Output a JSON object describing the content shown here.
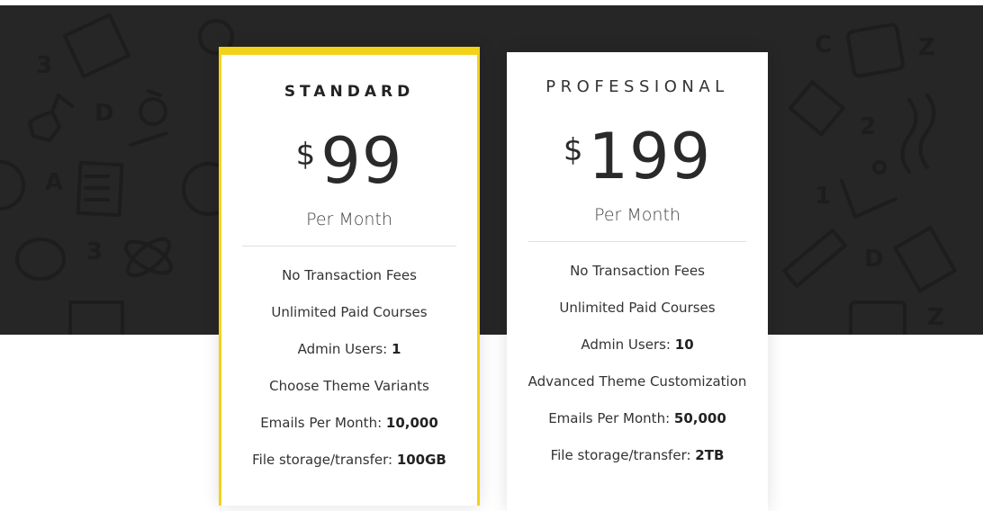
{
  "colors": {
    "accent": "#f2d318",
    "hero_background": "#262626",
    "card_background": "#ffffff",
    "text": "#333333"
  },
  "plans": [
    {
      "name": "STANDARD",
      "currency": "$",
      "amount": "99",
      "period": "Per Month",
      "highlighted": true,
      "features": [
        {
          "label": "No Transaction Fees",
          "value": ""
        },
        {
          "label": "Unlimited Paid Courses",
          "value": ""
        },
        {
          "label": "Admin Users: ",
          "value": "1"
        },
        {
          "label": "Choose Theme Variants",
          "value": ""
        },
        {
          "label": "Emails Per Month: ",
          "value": "10,000"
        },
        {
          "label": "File storage/transfer: ",
          "value": "100GB"
        }
      ]
    },
    {
      "name": "PROFESSIONAL",
      "currency": "$",
      "amount": "199",
      "period": "Per Month",
      "highlighted": false,
      "features": [
        {
          "label": "No Transaction Fees",
          "value": ""
        },
        {
          "label": "Unlimited Paid Courses",
          "value": ""
        },
        {
          "label": "Admin Users: ",
          "value": "10"
        },
        {
          "label": "Advanced Theme Customization",
          "value": ""
        },
        {
          "label": "Emails Per Month: ",
          "value": "50,000"
        },
        {
          "label": "File storage/transfer: ",
          "value": "2TB"
        }
      ]
    }
  ]
}
